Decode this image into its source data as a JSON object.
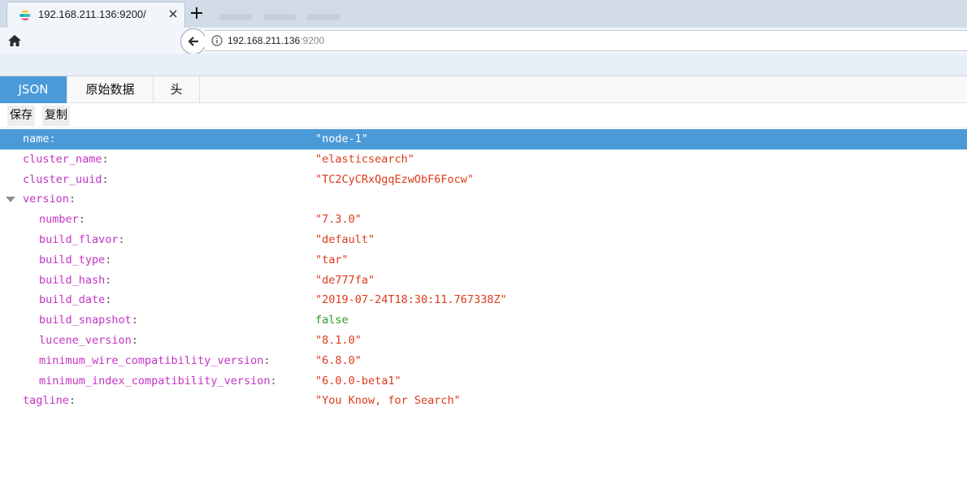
{
  "browser": {
    "tab_title": "192.168.211.136:9200/",
    "url_host": "192.168.211.136",
    "url_port": ":9200"
  },
  "viewer": {
    "tabs": [
      {
        "label": "JSON",
        "active": true
      },
      {
        "label": "原始数据",
        "active": false
      },
      {
        "label": "头",
        "active": false
      }
    ],
    "actions": {
      "save": "保存",
      "copy": "复制"
    },
    "rows": [
      {
        "key": "name",
        "value": "\"node-1\"",
        "selected": true
      },
      {
        "key": "cluster_name",
        "value": "\"elasticsearch\""
      },
      {
        "key": "cluster_uuid",
        "value": "\"TC2CyCRxQgqEzwObF6Focw\""
      },
      {
        "key": "version",
        "value": ""
      },
      {
        "key": "number",
        "value": "\"7.3.0\""
      },
      {
        "key": "build_flavor",
        "value": "\"default\""
      },
      {
        "key": "build_type",
        "value": "\"tar\""
      },
      {
        "key": "build_hash",
        "value": "\"de777fa\""
      },
      {
        "key": "build_date",
        "value": "\"2019-07-24T18:30:11.767338Z\""
      },
      {
        "key": "build_snapshot",
        "value": "false"
      },
      {
        "key": "lucene_version",
        "value": "\"8.1.0\""
      },
      {
        "key": "minimum_wire_compatibility_version",
        "value": "\"6.8.0\""
      },
      {
        "key": "minimum_index_compatibility_version",
        "value": "\"6.0.0-beta1\""
      },
      {
        "key": "tagline",
        "value": "\"You Know, for Search\""
      }
    ]
  },
  "colors": {
    "accent": "#4a9ad8",
    "key": "#c433c4",
    "string": "#dd3a1b",
    "boolean": "#2b9a2b"
  }
}
